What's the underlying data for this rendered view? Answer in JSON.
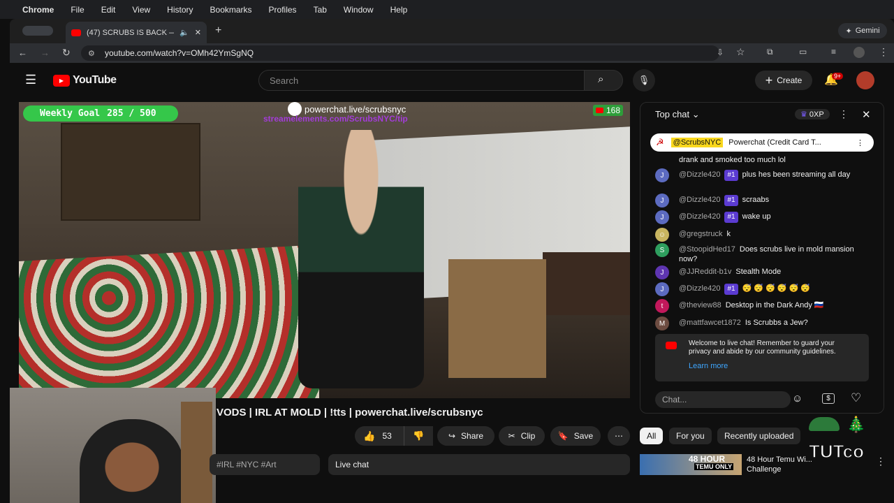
{
  "mac_menu": {
    "app": "Chrome",
    "items": [
      "File",
      "Edit",
      "View",
      "History",
      "Bookmarks",
      "Profiles",
      "Tab",
      "Window",
      "Help"
    ]
  },
  "browser": {
    "tab_title": "(47) SCRUBS IS BACK — ",
    "url": "youtube.com/watch?v=OMh42YmSgNQ",
    "gemini": "Gemini"
  },
  "youtube": {
    "logo": "YouTube",
    "search_placeholder": "Search",
    "create": "Create",
    "notif_count": "9+"
  },
  "overlay": {
    "goal_label": "Weekly Goal",
    "goal_value": "285 / 500",
    "powerchat": "powerchat.live/scrubsnyc",
    "streamelements": "streamelements.com/ScrubsNYC/tip",
    "viewers": "168"
  },
  "video": {
    "title": "VODS | IRL AT MOLD | !tts | powerchat.live/scrubsnyc",
    "tags": "#IRL #NYC #Art",
    "likes": "53",
    "share": "Share",
    "clip": "Clip",
    "save": "Save",
    "live_chat": "Live chat"
  },
  "chat": {
    "header": "Top chat",
    "xp": "0XP",
    "pinned_user": "@ScrubsNYC",
    "pinned_text": "Powerchat (Credit Card T...",
    "first_line": "drank and smoked too much lol",
    "messages": [
      {
        "avatar": "J",
        "user": "@Dizzle420",
        "rank": "#1",
        "text": "plus hes been streaming all day",
        "color": "#5c6bc0"
      },
      {
        "avatar": "J",
        "user": "@Dizzle420",
        "rank": "#1",
        "text": "scraabs",
        "color": "#5c6bc0"
      },
      {
        "avatar": "J",
        "user": "@Dizzle420",
        "rank": "#1",
        "text": "wake up",
        "color": "#5c6bc0"
      },
      {
        "avatar": "☺",
        "user": "@gregstruck",
        "rank": "",
        "text": "k",
        "color": "#c8b560"
      },
      {
        "avatar": "S",
        "user": "@StoopidHed17",
        "rank": "",
        "text": "Does scrubs live in mold mansion now?",
        "color": "#2e9e5e"
      },
      {
        "avatar": "J",
        "user": "@JJReddit-b1v",
        "rank": "",
        "text": "Stealth Mode",
        "color": "#5e35b1"
      },
      {
        "avatar": "J",
        "user": "@Dizzle420",
        "rank": "#1",
        "text": "😴 😴 😴 😴 😴 😴",
        "color": "#5c6bc0"
      },
      {
        "avatar": "t",
        "user": "@theview88",
        "rank": "",
        "text": "Desktop in the Dark Andy 🇷🇺",
        "color": "#c2185b"
      },
      {
        "avatar": "M",
        "user": "@mattfawcet1872",
        "rank": "",
        "text": "Is Scrubbs a Jew?",
        "color": "#6d4c41"
      }
    ],
    "welcome": "Welcome to live chat! Remember to guard your privacy and abide by our community guidelines.",
    "learn_more": "Learn more",
    "input_placeholder": "Chat..."
  },
  "recommend": {
    "chips": [
      "All",
      "For you",
      "Recently uploaded"
    ],
    "video_title": "48 Hour Temu Wi... Challenge",
    "thumb_text": "48 HOUR",
    "thumb_sub": "TEMU ONLY"
  },
  "watermark": "TUTco"
}
